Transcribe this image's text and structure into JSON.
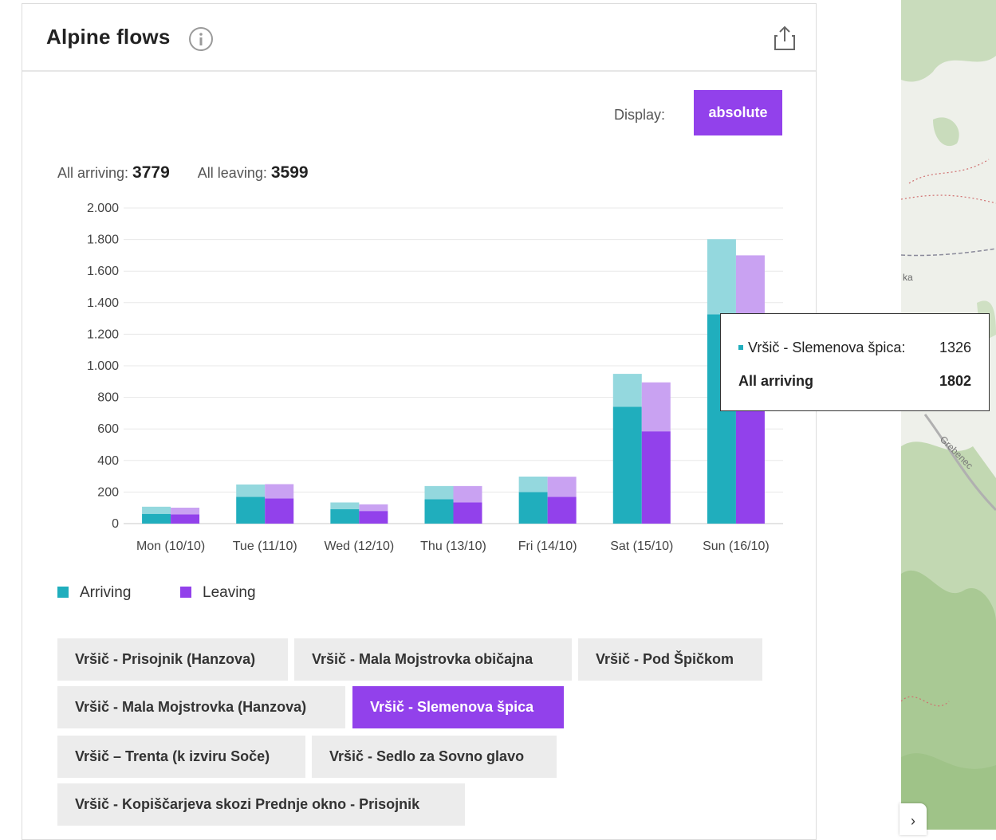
{
  "panel": {
    "title": "Alpine flows",
    "info_icon": "info-icon",
    "share_icon": "share-icon"
  },
  "display": {
    "label": "Display:",
    "value": "absolute"
  },
  "totals": {
    "arriving_label": "All arriving:",
    "arriving_value": "3779",
    "leaving_label": "All leaving:",
    "leaving_value": "3599"
  },
  "chart_data": {
    "type": "bar",
    "stacked": true,
    "categories": [
      "Mon (10/10)",
      "Tue (11/10)",
      "Wed (12/10)",
      "Thu (13/10)",
      "Fri (14/10)",
      "Sat (15/10)",
      "Sun (16/10)"
    ],
    "y_ticks": [
      "0",
      "200",
      "400",
      "600",
      "800",
      "1.000",
      "1.200",
      "1.400",
      "1.600",
      "1.800",
      "2.000"
    ],
    "ylim": [
      0,
      2000
    ],
    "grid": true,
    "series": [
      {
        "name": "Arriving",
        "group": "arriving",
        "part": "selected route",
        "color": "#20aebd",
        "values": [
          62,
          170,
          92,
          155,
          200,
          740,
          1326
        ]
      },
      {
        "name": "Arriving",
        "group": "arriving",
        "part": "other routes",
        "color": "#94d8de",
        "values": [
          45,
          78,
          42,
          83,
          98,
          209,
          476
        ]
      },
      {
        "name": "Leaving",
        "group": "leaving",
        "part": "selected route",
        "color": "#9241eb",
        "values": [
          58,
          160,
          80,
          135,
          170,
          585,
          1180
        ]
      },
      {
        "name": "Leaving",
        "group": "leaving",
        "part": "other routes",
        "color": "#c9a2f2",
        "values": [
          43,
          90,
          42,
          103,
          127,
          310,
          520
        ]
      }
    ]
  },
  "legend": [
    {
      "label": "Arriving",
      "color": "#20aebd"
    },
    {
      "label": "Leaving",
      "color": "#9241eb"
    }
  ],
  "routes": [
    {
      "label": "Vršič - Prisojnik (Hanzova)",
      "active": false
    },
    {
      "label": "Vršič - Mala Mojstrovka običajna",
      "active": false
    },
    {
      "label": "Vršič - Pod Špičkom",
      "active": false
    },
    {
      "label": "Vršič - Mala Mojstrovka (Hanzova)",
      "active": false
    },
    {
      "label": "Vršič - Slemenova špica",
      "active": true
    },
    {
      "label": "Vršič – Trenta (k izviru Soče)",
      "active": false
    },
    {
      "label": "Vršič - Sedlo za Sovno glavo",
      "active": false
    },
    {
      "label": "Vršič - Kopiščarjeva skozi Prednje okno - Prisojnik",
      "active": false
    }
  ],
  "tooltip": {
    "series_label": "Vršič - Slemenova špica:",
    "series_value": "1326",
    "series_color": "#20aebd",
    "total_label": "All arriving",
    "total_value": "1802"
  },
  "map": {
    "labels": [
      "ka",
      "Grebenec"
    ],
    "expand_icon": "chevron-right-icon"
  }
}
